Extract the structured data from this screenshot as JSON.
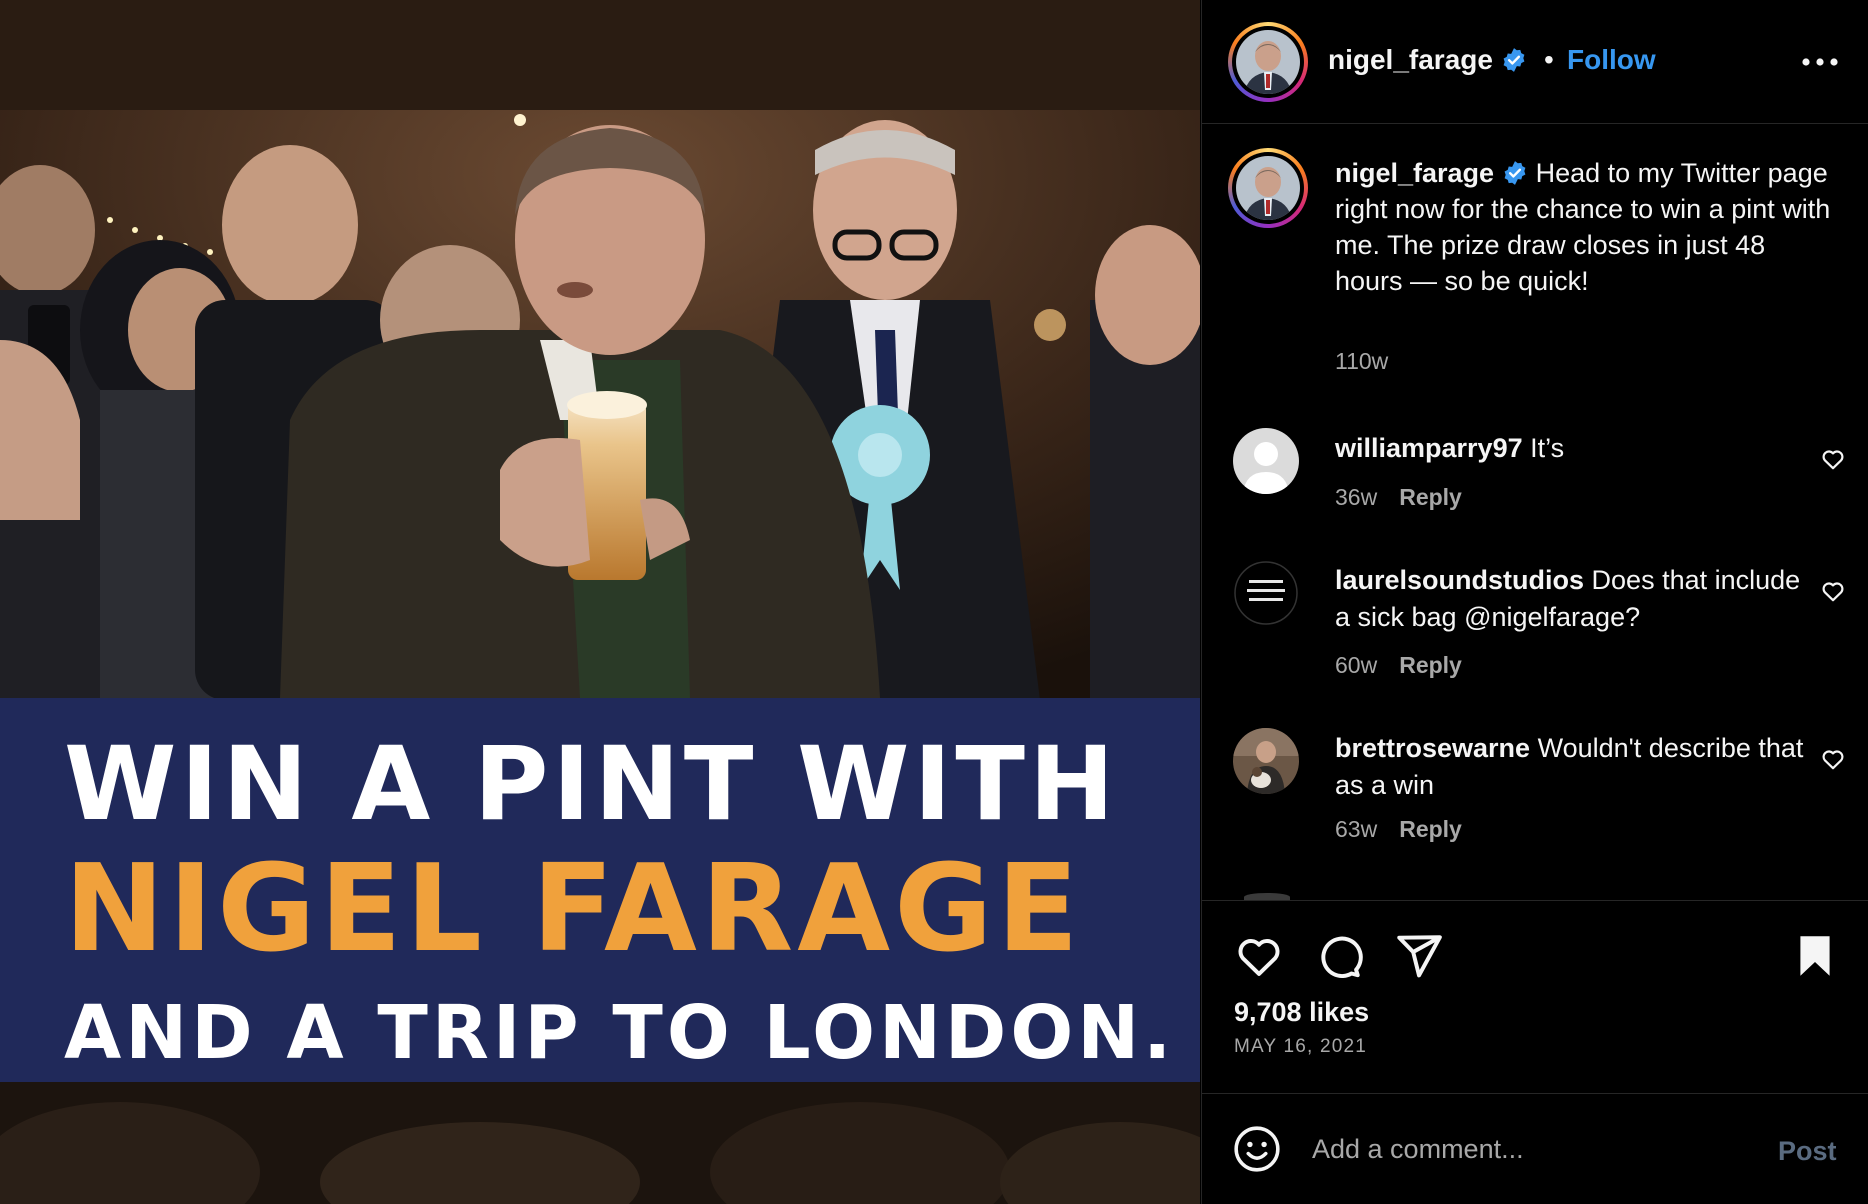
{
  "post_image": {
    "banner": {
      "line1": "WIN A PINT WITH",
      "line2": "NIGEL FARAGE",
      "line3": "AND A TRIP TO LONDON."
    }
  },
  "header": {
    "username": "nigel_farage",
    "separator": "•",
    "follow_label": "Follow",
    "more_icon": "more-horizontal-icon"
  },
  "caption": {
    "username": "nigel_farage",
    "text": "Head to my Twitter page right now for the chance to win a pint with me. The prize draw closes in just 48 hours — so be quick!",
    "time": "110w"
  },
  "comments": [
    {
      "username": "williamparry97",
      "text": "It’s",
      "time": "36w",
      "reply_label": "Reply",
      "avatar": "default-avatar-icon"
    },
    {
      "username": "laurelsoundstudios",
      "text": "Does that include a sick bag @nigelfarage?",
      "time": "60w",
      "reply_label": "Reply",
      "avatar": "laurel-sound-studios-logo"
    },
    {
      "username": "brettrosewarne",
      "text": "Wouldn't describe that as a win",
      "time": "63w",
      "reply_label": "Reply",
      "avatar": "photo-avatar"
    }
  ],
  "actions": {
    "icons": [
      "heart-icon",
      "comment-icon",
      "share-icon",
      "bookmark-icon"
    ],
    "likes": "9,708 likes",
    "date": "MAY 16, 2021"
  },
  "composer": {
    "placeholder": "Add a comment...",
    "post_label": "Post",
    "emoji_icon": "emoji-icon"
  },
  "colors": {
    "background": "#000000",
    "follow_blue": "#3797f0",
    "verified_blue": "#3897f0",
    "banner_navy": "#20295a",
    "banner_orange": "#f0a13c",
    "muted_text": "#a8a8a8"
  }
}
